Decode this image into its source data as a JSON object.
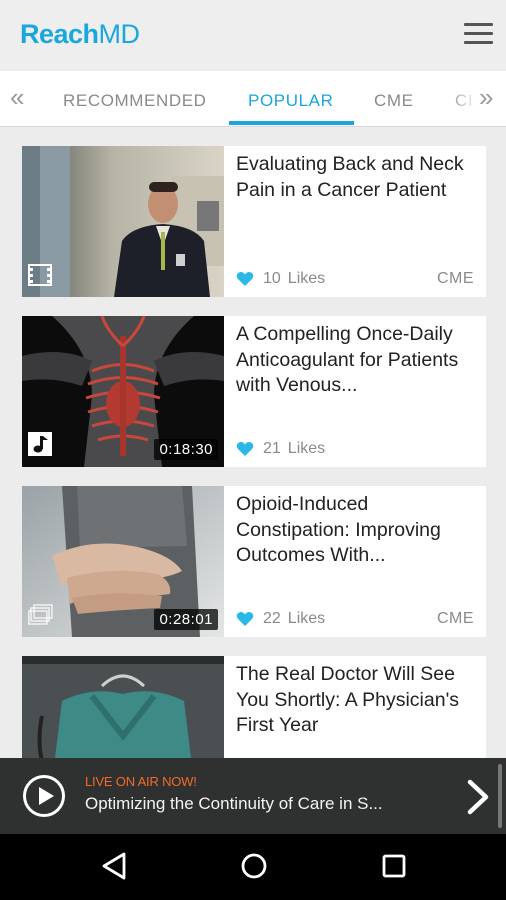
{
  "header": {
    "logo_reach": "Reach",
    "logo_md": "MD"
  },
  "tabs": [
    {
      "label": "RECOMMENDED",
      "active": false
    },
    {
      "label": "POPULAR",
      "active": true
    },
    {
      "label": "CME",
      "active": false
    },
    {
      "label": "CI",
      "active": false
    }
  ],
  "articles": [
    {
      "title": "Evaluating Back and Neck Pain in a Cancer Patient",
      "likes": "10",
      "likes_label": "Likes",
      "badge": "CME",
      "duration": "",
      "media_icon": "film-icon"
    },
    {
      "title": "A Compelling Once-Daily Anticoagulant for Patients with Venous...",
      "likes": "21",
      "likes_label": "Likes",
      "badge": "",
      "duration": "0:18:30",
      "media_icon": "music-note-icon"
    },
    {
      "title": "Opioid-Induced Constipation: Improving Outcomes With...",
      "likes": "22",
      "likes_label": "Likes",
      "badge": "CME",
      "duration": "0:28:01",
      "media_icon": "stack-icon"
    },
    {
      "title": "The Real Doctor Will See You Shortly: A Physician's First Year",
      "likes": "",
      "likes_label": "",
      "badge": "",
      "duration": "",
      "media_icon": ""
    }
  ],
  "now_playing": {
    "live_label": "LIVE ON AIR NOW!",
    "title": "Optimizing the Continuity of Care in S..."
  },
  "colors": {
    "accent": "#1aa7dc",
    "live": "#f26b2a",
    "now_bar": "#2f3030"
  }
}
